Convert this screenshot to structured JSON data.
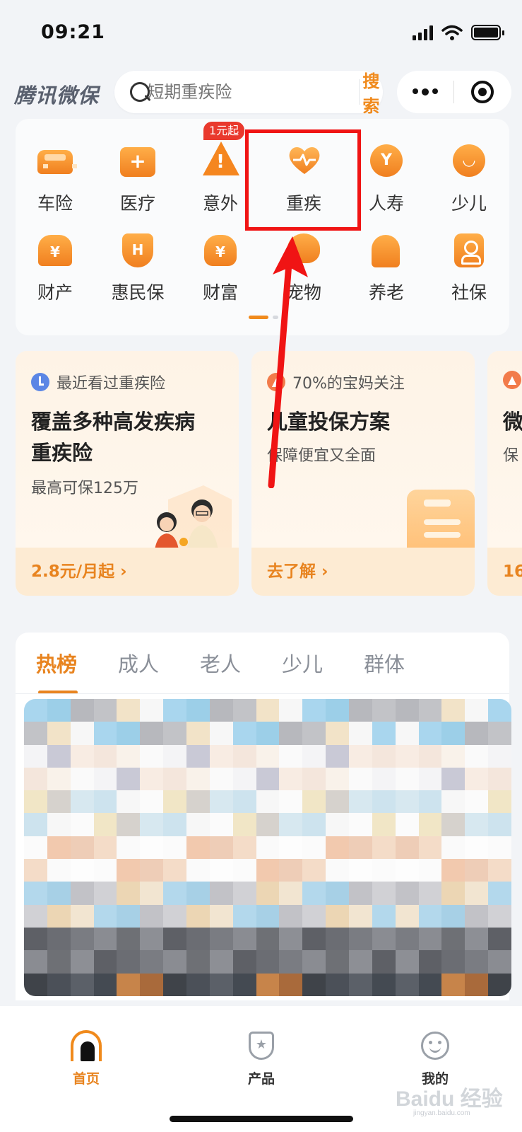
{
  "status_bar": {
    "time": "09:21"
  },
  "header": {
    "brand": "腾讯微保",
    "search_placeholder": "短期重疾险",
    "search_button": "搜索"
  },
  "categories": {
    "row1": [
      "车险",
      "医疗",
      "意外",
      "重疾",
      "人寿",
      "少儿"
    ],
    "row2": [
      "财产",
      "惠民保",
      "财富",
      "宠物",
      "养老",
      "社保"
    ],
    "promo_badge": "1元起",
    "icon_names": [
      "car-icon",
      "medical-icon",
      "accident-icon",
      "heart-icon",
      "life-icon",
      "child-icon",
      "property-icon",
      "shield-icon",
      "wealth-icon",
      "pet-icon",
      "elder-icon",
      "social-card-icon"
    ]
  },
  "cards": [
    {
      "tag": "最近看过重疾险",
      "title_line1": "覆盖多种高发疾病",
      "title_line2": "重疾险",
      "subtitle": "最高可保125万",
      "footer": "2.8元/月起 ›"
    },
    {
      "tag": "70%的宝妈关注",
      "title_line1": "儿童投保方案",
      "subtitle": "保障便宜又全面",
      "footer": "去了解 ›"
    },
    {
      "title_line1": "微",
      "subtitle": "保",
      "footer": "16"
    }
  ],
  "tabs": [
    "热榜",
    "成人",
    "老人",
    "少儿",
    "群体"
  ],
  "bottom_nav": {
    "home": "首页",
    "products": "产品",
    "me": "我的"
  },
  "watermark": {
    "brand": "Baidu 经验",
    "url": "jingyan.baidu.com"
  },
  "colors": {
    "accent": "#e88420",
    "highlight": "#f01414",
    "badge": "#e9392d"
  }
}
